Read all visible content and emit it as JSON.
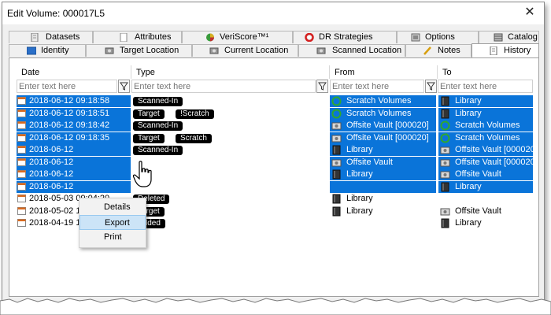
{
  "window": {
    "title": "Edit Volume: 000017L5"
  },
  "tabs_top": [
    {
      "label": "Datasets",
      "icon": "datasets-icon"
    },
    {
      "label": "Attributes",
      "icon": "attributes-icon"
    },
    {
      "label": "VeriScore™¹",
      "icon": "veriscore-icon"
    },
    {
      "label": "DR Strategies",
      "icon": "dr-strategies-icon"
    },
    {
      "label": "Options",
      "icon": "options-icon"
    },
    {
      "label": "Catalog",
      "icon": "catalog-icon"
    }
  ],
  "tabs_bottom": [
    {
      "label": "Identity",
      "icon": "identity-icon"
    },
    {
      "label": "Target Location",
      "icon": "target-location-icon"
    },
    {
      "label": "Current Location",
      "icon": "current-location-icon"
    },
    {
      "label": "Scanned Location",
      "icon": "scanned-location-icon"
    },
    {
      "label": "Notes",
      "icon": "notes-icon"
    },
    {
      "label": "History",
      "icon": "history-icon"
    }
  ],
  "grid": {
    "columns": [
      "Date",
      "Type",
      "From",
      "To"
    ],
    "filter_placeholder": "Enter text here",
    "rows": [
      {
        "date": "2018-06-12 09:18:58",
        "type": [
          "Scanned-In"
        ],
        "from": "Scratch Volumes",
        "to": "Library",
        "selected": true
      },
      {
        "date": "2018-06-12 09:18:51",
        "type": [
          "Target",
          "!Scratch"
        ],
        "from": "Scratch Volumes",
        "to": "Library",
        "selected": true
      },
      {
        "date": "2018-06-12 09:18:42",
        "type": [
          "Scanned-In"
        ],
        "from": "Offsite Vault [000020]",
        "to": "Scratch Volumes",
        "selected": true
      },
      {
        "date": "2018-06-12 09:18:35",
        "type": [
          "Target",
          "Scratch"
        ],
        "from": "Offsite Vault [000020]",
        "to": "Scratch Volumes",
        "selected": true
      },
      {
        "date": "2018-06-12",
        "type": [
          "Scanned-In"
        ],
        "from": "Library",
        "to": "Offsite Vault [000020]",
        "selected": true
      },
      {
        "date": "2018-06-12",
        "type": [
          ""
        ],
        "from": "Offsite Vault",
        "to": "Offsite Vault [000020]",
        "selected": true
      },
      {
        "date": "2018-06-12",
        "type": [
          ""
        ],
        "from": "Library",
        "to": "Offsite Vault",
        "selected": true
      },
      {
        "date": "2018-06-12",
        "type": [
          ""
        ],
        "from": "",
        "to": "Library",
        "selected": true
      },
      {
        "date": "2018-05-03 09:04:20",
        "type": [
          "Deleted"
        ],
        "from": "Library",
        "to": "",
        "selected": false
      },
      {
        "date": "2018-05-02 12:49:28",
        "type": [
          "Target"
        ],
        "from": "Library",
        "to": "Offsite Vault",
        "selected": false
      },
      {
        "date": "2018-04-19 11:26:28",
        "type": [
          "Added"
        ],
        "from": "",
        "to": "Library",
        "selected": false
      }
    ]
  },
  "context_menu": {
    "items": [
      "Details",
      "Export",
      "Print"
    ],
    "highlighted": "Export"
  },
  "colors": {
    "selection": "#0a74d9",
    "pill": "#000000",
    "menu_highlight": "#cce4f7"
  }
}
